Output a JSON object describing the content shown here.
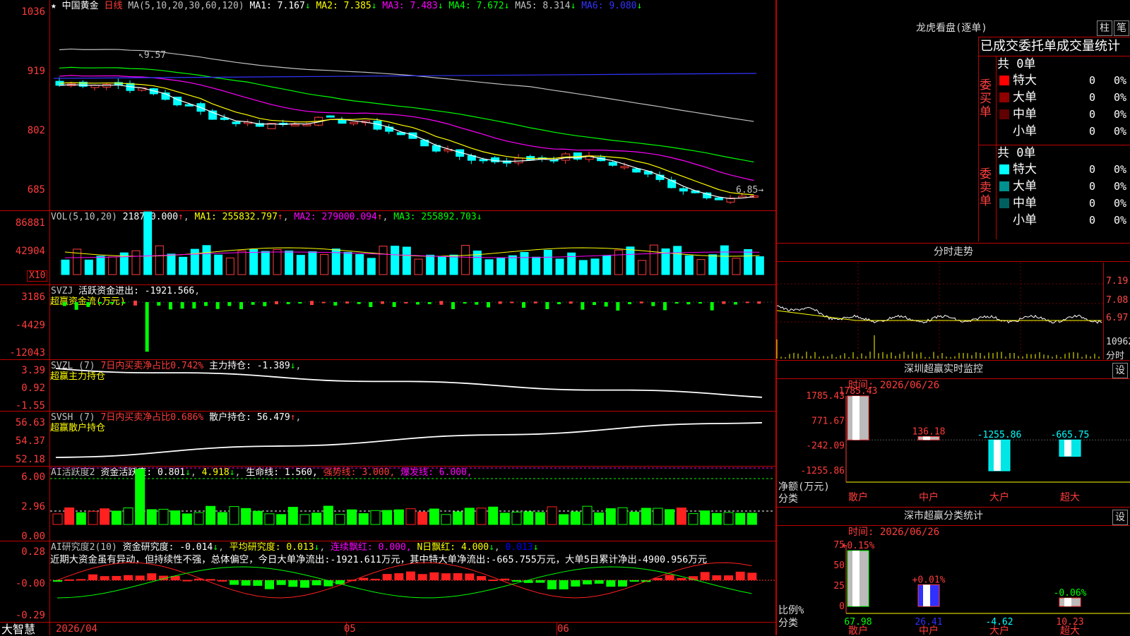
{
  "app": {
    "brand": "大智慧",
    "star": "★",
    "stock_name": "中国黄金",
    "period": "日线"
  },
  "colors": {
    "up": "#ff3c3c",
    "down": "#00ffff",
    "ma1": "#ffffff",
    "ma2": "#ffff00",
    "ma3": "#ff00ff",
    "ma4": "#00ff00",
    "ma5": "#c0c0c0",
    "ma6": "#3333ff",
    "accent_red": "#c00000"
  },
  "price_panel": {
    "header": "MA(5,10,20,30,60,120)",
    "ma_labels": [
      {
        "label": "MA1: 7.167",
        "arrow": "↓"
      },
      {
        "label": "MA2: 7.385",
        "arrow": "↓"
      },
      {
        "label": "MA3: 7.483",
        "arrow": "↓"
      },
      {
        "label": "MA4: 7.672",
        "arrow": "↓"
      },
      {
        "label": "MA5: 8.314",
        "arrow": "↓"
      },
      {
        "label": "MA6: 9.080",
        "arrow": "↓"
      }
    ],
    "y_ticks": [
      "1036",
      "919",
      "802",
      "685"
    ],
    "high_note": "9.57",
    "low_note": "6.85"
  },
  "vol_panel": {
    "header": "VOL(5,10,20)",
    "value": "218700.000",
    "ma1": "MA1: 255832.797",
    "ma2": "MA2: 279000.094",
    "ma3": "MA3: 255892.703",
    "y_ticks": [
      "86881",
      "42904"
    ],
    "unit": "X10"
  },
  "svzj_panel": {
    "header": "SVZJ",
    "label": "活跃资金进出: -1921.566",
    "sub": "超赢资金流(万元)",
    "y_ticks": [
      "3186",
      "-4429",
      "-12043"
    ]
  },
  "svzl_panel": {
    "header": "SVZL (7)",
    "label1": "7日内买卖净占比0.742%",
    "label2": "主力持仓: -1.389",
    "sub": "超赢主力持仓",
    "y_ticks": [
      "3.39",
      "0.92",
      "-1.55"
    ]
  },
  "svsh_panel": {
    "header": "SVSH (7)",
    "label1": "7日内买卖净占比0.686%",
    "label2": "散户持仓: 56.479",
    "sub": "超赢散户持仓",
    "y_ticks": [
      "56.63",
      "54.37",
      "52.18"
    ]
  },
  "ai1_panel": {
    "header": "AI活跃度2",
    "a": "资金活跃度: 0.801",
    "b": "4.918",
    "c": "生命线: 1.560,",
    "d": "强势线: 3.000,",
    "e": "爆发线: 6.000,",
    "y_ticks": [
      "6.00",
      "2.96",
      "0.00"
    ]
  },
  "ai2_panel": {
    "header": "AI研究度2(10)",
    "a": "资金研究度: -0.014",
    "b": "平均研究度: 0.013",
    "c": "连续飘红: 0.000,",
    "d": "N日飘红: 4.000",
    "e": "0.013",
    "comment": "近期大资金虽有异动，但持续性不强，总体偏空，今日大单净流出:-1921.611万元，其中特大单净流出:-665.755万元，大单5日累计净出-4900.956万元",
    "y_ticks": [
      "0.28",
      "-0.00",
      "-0.29"
    ]
  },
  "time_axis": [
    "2026/04",
    "05",
    "06"
  ],
  "right": {
    "dragon": {
      "title": "龙虎看盘(逐单)",
      "btn1": "柱",
      "btn2": "笔",
      "subtitle": "已成交委托单成交量统计",
      "buy_total": "共 0单",
      "sell_total": "共 0单",
      "buy_label": [
        "委",
        "买",
        "单"
      ],
      "sell_label": [
        "委",
        "卖",
        "单"
      ],
      "buy_rows": [
        {
          "name": "特大",
          "val": "0",
          "pct": "0%",
          "color": "#ff0000"
        },
        {
          "name": "大单",
          "val": "0",
          "pct": "0%",
          "color": "#900000"
        },
        {
          "name": "中单",
          "val": "0",
          "pct": "0%",
          "color": "#600000"
        },
        {
          "name": "小单",
          "val": "0",
          "pct": "0%",
          "color": ""
        }
      ],
      "sell_rows": [
        {
          "name": "特大",
          "val": "0",
          "pct": "0%",
          "color": "#00ffff"
        },
        {
          "name": "大单",
          "val": "0",
          "pct": "0%",
          "color": "#009090"
        },
        {
          "name": "中单",
          "val": "0",
          "pct": "0%",
          "color": "#006060"
        },
        {
          "name": "小单",
          "val": "0",
          "pct": "0%",
          "color": ""
        }
      ]
    },
    "intraday": {
      "title": "分时走势",
      "ticks": [
        "7.19",
        "7.08",
        "6.97"
      ],
      "vol": "10962",
      "vol_unit": "分时"
    },
    "monitor": {
      "title": "深圳超赢实时监控",
      "btn": "设",
      "time": "时间: 2026/06/26",
      "y_ticks": [
        "1785.43",
        "771.67",
        "-242.09",
        "-1255.86"
      ],
      "ylabel": "净额(万元)",
      "xlabel": "分类",
      "categories": [
        "散户",
        "中户",
        "大户",
        "超大"
      ],
      "values": [
        1785.43,
        136.18,
        -1255.86,
        -665.75
      ],
      "value_labels": [
        "1785.43",
        "136.18",
        "-1255.86",
        "-665.75"
      ]
    },
    "classify": {
      "title": "深市超赢分类统计",
      "btn": "设",
      "time": "时间: 2026/06/26",
      "y_ticks": [
        "75",
        "50",
        "25",
        "0"
      ],
      "ylabel": "比例%",
      "xlabel": "分类",
      "categories": [
        "散户",
        "中户",
        "大户",
        "超大"
      ],
      "values": [
        67.98,
        26.41,
        -4.62,
        10.23
      ],
      "value_labels": [
        "67.98",
        "26.41",
        "-4.62",
        "10.23"
      ],
      "change_labels": [
        "+0.15%",
        "+0.01%",
        "",
        "-0.06%"
      ]
    }
  }
}
